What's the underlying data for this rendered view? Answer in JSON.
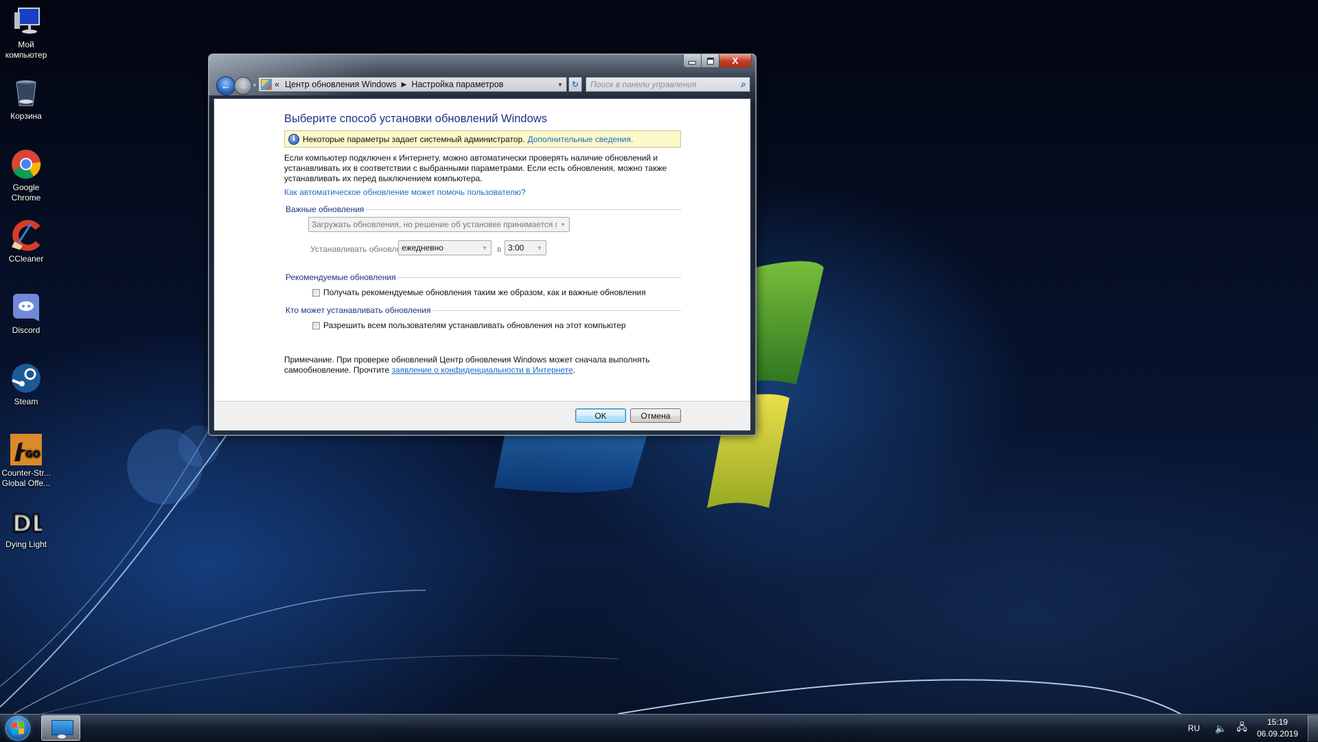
{
  "desktop": {
    "icons": [
      {
        "label": "Мой компьютер",
        "icon": "computer-icon"
      },
      {
        "label": "Корзина",
        "icon": "recycle-bin-icon"
      },
      {
        "label": "Google Chrome",
        "icon": "chrome-icon"
      },
      {
        "label": "CCleaner",
        "icon": "ccleaner-icon"
      },
      {
        "label": "Discord",
        "icon": "discord-icon"
      },
      {
        "label": "Steam",
        "icon": "steam-icon"
      },
      {
        "label": "Counter-Str... Global Offe...",
        "icon": "csgo-icon"
      },
      {
        "label": "Dying Light",
        "icon": "dying-light-icon"
      }
    ]
  },
  "window": {
    "caption_buttons": {
      "minimize": "minimize",
      "maximize": "maximize",
      "close": "X"
    },
    "nav": {
      "back_icon": "←",
      "forward_icon": "→",
      "breadcrumb_prefix": "«",
      "breadcrumbs": [
        "Центр обновления Windows",
        "Настройка параметров"
      ],
      "separator": "▶",
      "refresh_icon": "↻"
    },
    "search": {
      "placeholder": "Поиск в панели управления",
      "value": ""
    },
    "content": {
      "title": "Выберите способ установки обновлений Windows",
      "info_bar": {
        "text": "Некоторые параметры задает системный администратор.",
        "link": "Дополнительные сведения."
      },
      "description": "Если компьютер подключен к Интернету, можно автоматически проверять наличие обновлений и устанавливать их в соответствии с выбранными параметрами. Если есть обновления, можно также устанавливать их перед выключением компьютера.",
      "help_link": "Как автоматическое обновление может помочь пользователю?",
      "important_updates": {
        "heading": "Важные обновления",
        "mode_selected": "Загружать обновления, но решение об установке принимается мной",
        "install_label": "Устанавливать обновления:",
        "day_selected": "ежедневно",
        "at_label": "в",
        "time_selected": "3:00"
      },
      "recommended_updates": {
        "heading": "Рекомендуемые обновления",
        "checkbox_label": "Получать рекомендуемые обновления таким же образом, как и важные обновления",
        "checked": false
      },
      "who_can_install": {
        "heading": "Кто может устанавливать обновления",
        "checkbox_label": "Разрешить всем пользователям устанавливать обновления на этот компьютер",
        "checked": false
      },
      "note": {
        "text": "Примечание. При проверке обновлений Центр обновления Windows может сначала выполнять самообновление. Прочтите",
        "link": "заявление о конфиденциальности в Интернете",
        "end": "."
      }
    },
    "footer": {
      "ok_label": "OK",
      "cancel_label": "Отмена"
    }
  },
  "taskbar": {
    "language": "RU",
    "time": "15:19",
    "date": "06.09.2019"
  }
}
